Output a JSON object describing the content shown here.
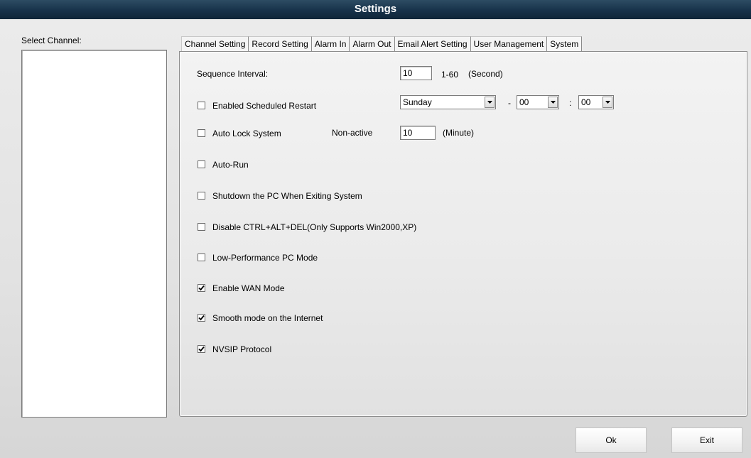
{
  "window": {
    "title": "Settings"
  },
  "channel_panel": {
    "label": "Select Channel:"
  },
  "tabs": [
    {
      "label": "Channel Setting"
    },
    {
      "label": "Record Setting"
    },
    {
      "label": "Alarm In"
    },
    {
      "label": "Alarm Out"
    },
    {
      "label": "Email Alert Setting"
    },
    {
      "label": "User Management"
    },
    {
      "label": "System"
    }
  ],
  "system": {
    "sequence_interval": {
      "label": "Sequence Interval:",
      "value": "10",
      "range": "1-60",
      "unit": "(Second)"
    },
    "scheduled_restart": {
      "label": "Enabled Scheduled Restart",
      "checked": false,
      "day": "Sunday",
      "dash": "-",
      "hour": "00",
      "colon": ":",
      "minute": "00"
    },
    "auto_lock": {
      "label": "Auto Lock System",
      "checked": false,
      "nonactive_label": "Non-active",
      "value": "10",
      "unit": "(Minute)"
    },
    "auto_run": {
      "label": "Auto-Run",
      "checked": false
    },
    "shutdown": {
      "label": "Shutdown the PC When Exiting System",
      "checked": false
    },
    "disable_cad": {
      "label": "Disable CTRL+ALT+DEL(Only Supports Win2000,XP)",
      "checked": false
    },
    "low_perf": {
      "label": "Low-Performance PC Mode",
      "checked": false
    },
    "wan_mode": {
      "label": "Enable WAN Mode",
      "checked": true
    },
    "smooth_mode": {
      "label": "Smooth mode on the Internet",
      "checked": true
    },
    "nvsip": {
      "label": "NVSIP Protocol",
      "checked": true
    }
  },
  "buttons": {
    "ok": "Ok",
    "exit": "Exit"
  },
  "icons": {
    "check": "checkmark-icon",
    "dropdown": "chevron-down-icon"
  }
}
